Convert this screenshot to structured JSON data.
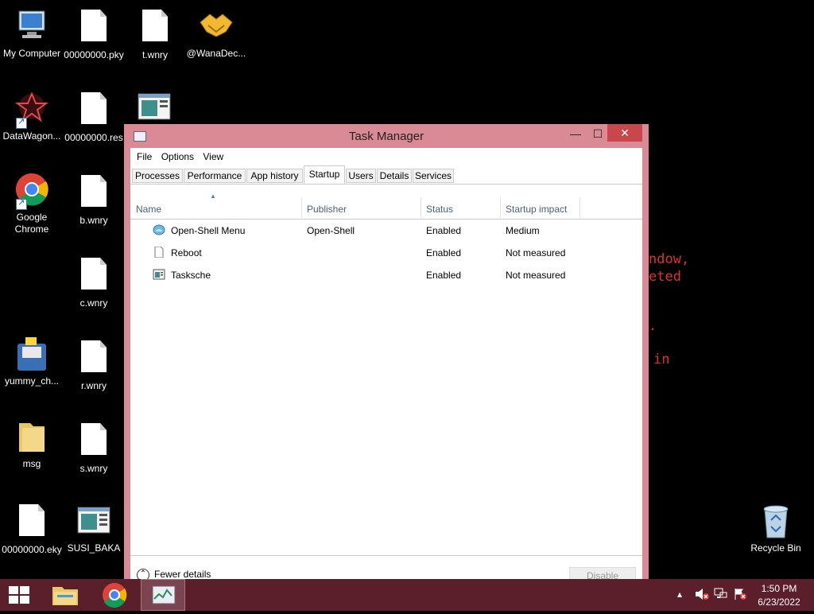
{
  "desktop": {
    "icons": [
      {
        "label": "My Computer"
      },
      {
        "label": "00000000.pky"
      },
      {
        "label": "t.wnry"
      },
      {
        "label": "@WanaDec..."
      },
      {
        "label": "DataWagon..."
      },
      {
        "label": "00000000.res"
      },
      {
        "label": "Google\nChrome"
      },
      {
        "label": "b.wnry"
      },
      {
        "label": "c.wnry"
      },
      {
        "label": "yummy_ch..."
      },
      {
        "label": "r.wnry"
      },
      {
        "label": "msg"
      },
      {
        "label": "s.wnry"
      },
      {
        "label": "00000000.eky"
      },
      {
        "label": "SUSI_BAKA"
      },
      {
        "label": "Recycle Bin"
      }
    ],
    "background_text": [
      "ndow,",
      "eted",
      ".",
      "in"
    ]
  },
  "window": {
    "title": "Task Manager",
    "minimize": "—",
    "maximize": "☐",
    "close": "✕",
    "menu": [
      "File",
      "Options",
      "View"
    ],
    "tabs": [
      "Processes",
      "Performance",
      "App history",
      "Startup",
      "Users",
      "Details",
      "Services"
    ],
    "active_tab": "Startup",
    "columns": [
      "Name",
      "Publisher",
      "Status",
      "Startup impact"
    ],
    "rows": [
      {
        "name": "Open-Shell Menu",
        "publisher": "Open-Shell",
        "status": "Enabled",
        "impact": "Medium"
      },
      {
        "name": "Reboot",
        "publisher": "",
        "status": "Enabled",
        "impact": "Not measured"
      },
      {
        "name": "Tasksche",
        "publisher": "",
        "status": "Enabled",
        "impact": "Not measured"
      }
    ],
    "fewer_details": "Fewer details",
    "disable": "Disable"
  },
  "taskbar": {
    "time": "1:50 PM",
    "date": "6/23/2022"
  },
  "colors": {
    "window_frame": "#d98a95",
    "close_button": "#c9464d",
    "taskbar": "#5a1f2b",
    "ransom_text": "#e0302d"
  }
}
